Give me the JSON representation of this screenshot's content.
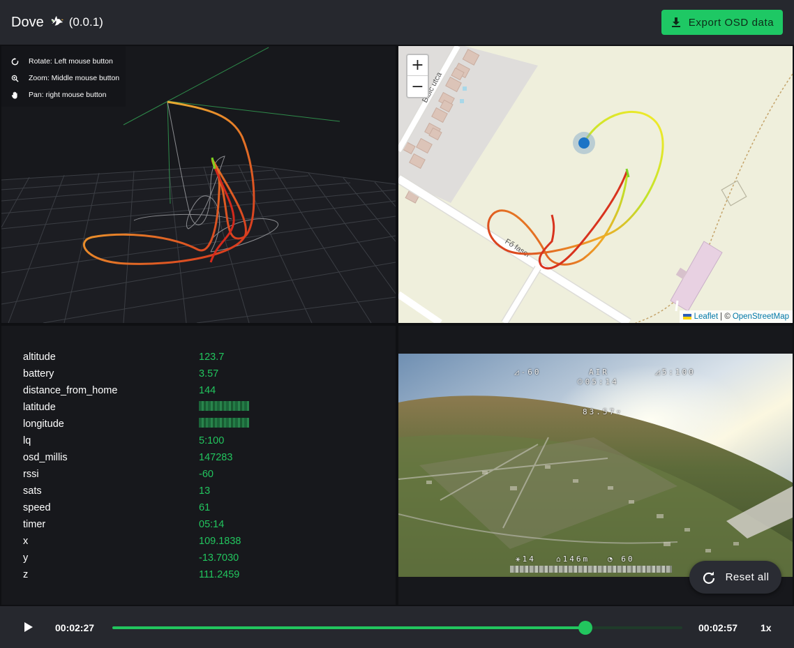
{
  "header": {
    "title": "Dove",
    "version": "(0.0.1)",
    "export_label": "Export OSD data"
  },
  "viewer3d": {
    "help": [
      {
        "icon": "rotate-icon",
        "text": "Rotate: Left mouse button"
      },
      {
        "icon": "zoom-icon",
        "text": "Zoom: Middle mouse button"
      },
      {
        "icon": "hand-icon",
        "text": "Pan: right mouse button"
      }
    ]
  },
  "map": {
    "zoom_in": "+",
    "zoom_out": "−",
    "street_1": "Bibic utca",
    "street_2": "Fő fasor",
    "attribution_leaflet": "Leaflet",
    "attribution_sep": "| ©",
    "attribution_osm": "OpenStreetMap"
  },
  "telemetry": [
    {
      "key": "altitude",
      "value": "123.7"
    },
    {
      "key": "battery",
      "value": "3.57"
    },
    {
      "key": "distance_from_home",
      "value": "144"
    },
    {
      "key": "latitude",
      "value": "",
      "blurred": true
    },
    {
      "key": "longitude",
      "value": "",
      "blurred": true
    },
    {
      "key": "lq",
      "value": "5:100"
    },
    {
      "key": "osd_millis",
      "value": "147283"
    },
    {
      "key": "rssi",
      "value": "-60"
    },
    {
      "key": "sats",
      "value": "13"
    },
    {
      "key": "speed",
      "value": "61"
    },
    {
      "key": "timer",
      "value": "05:14"
    },
    {
      "key": "x",
      "value": "109.1838"
    },
    {
      "key": "y",
      "value": "-13.7030"
    },
    {
      "key": "z",
      "value": "111.2459"
    }
  ],
  "video": {
    "osd_rssi": "◿-60",
    "osd_air": "AIR",
    "osd_lq": "◿5:100",
    "osd_timer": "⏱05:14",
    "osd_alt": "83.57▿",
    "osd_sats": "⚹14",
    "osd_home": "⌂146m",
    "osd_speed": "◔ 60",
    "reset_label": "Reset all"
  },
  "player": {
    "current_time": "00:02:27",
    "total_time": "00:02:57",
    "progress": 0.83,
    "speed": "1x"
  },
  "colors": {
    "accent": "#22c55e",
    "header_bg": "#26282e",
    "panel_bg": "#17181c"
  }
}
